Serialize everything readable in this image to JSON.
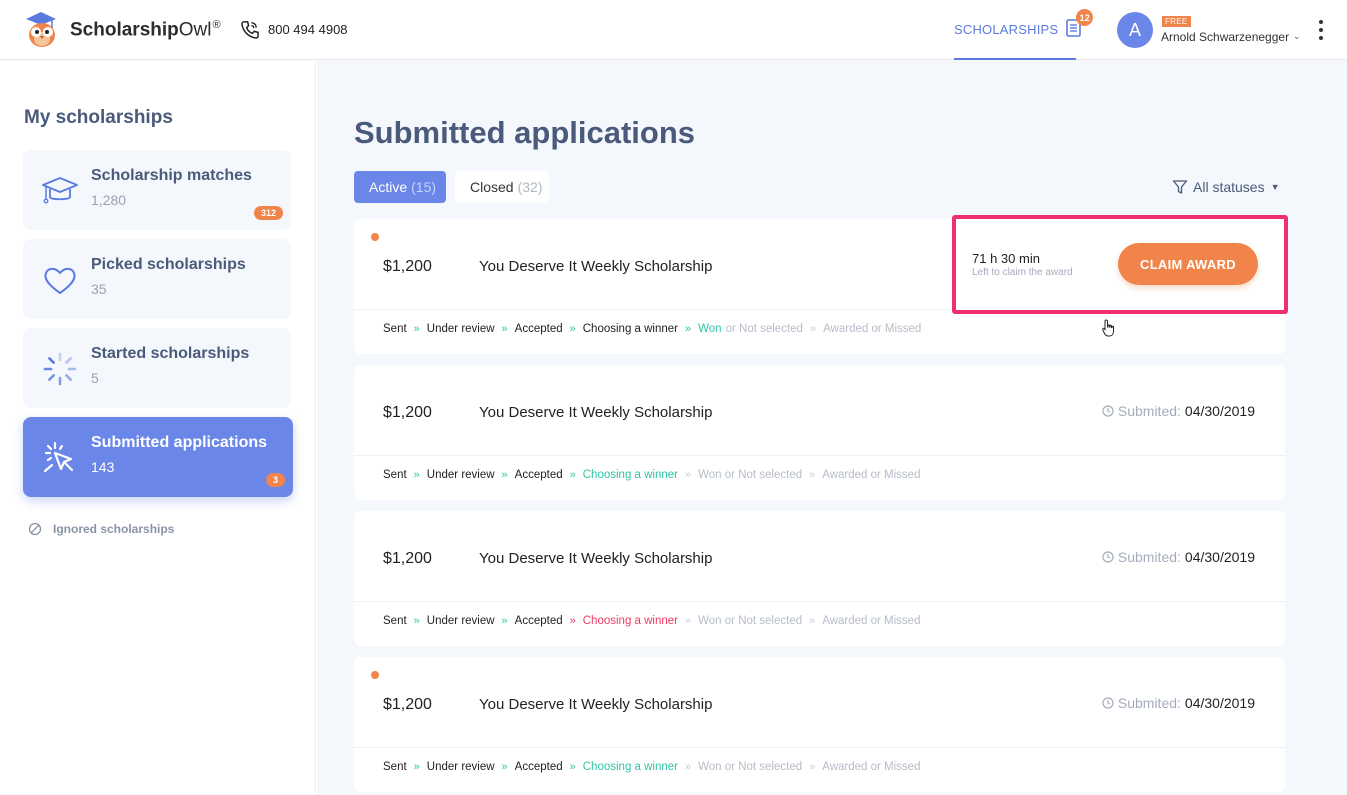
{
  "header": {
    "logo_main": "Scholarship",
    "logo_owl": "Owl",
    "logo_reg": "®",
    "phone": "800 494 4908",
    "nav_scholarships": "SCHOLARSHIPS",
    "nav_badge": "12",
    "avatar_letter": "A",
    "plan_badge": "FREE",
    "username": "Arnold Schwarzenegger",
    "chevron": "⌄"
  },
  "sidebar": {
    "title": "My scholarships",
    "items": [
      {
        "label": "Scholarship matches",
        "count": "1,280",
        "badge": "312",
        "icon": "graduation-cap-icon"
      },
      {
        "label": "Picked scholarships",
        "count": "35",
        "icon": "heart-icon"
      },
      {
        "label": "Started scholarships",
        "count": "5",
        "icon": "loading-spinner-icon"
      },
      {
        "label": "Submitted applications",
        "count": "143",
        "badge": "3",
        "icon": "cursor-click-icon",
        "active": true
      }
    ],
    "ignored": "Ignored scholarships"
  },
  "main": {
    "title": "Submitted applications",
    "tabs": {
      "active_label": "Active",
      "active_count": "(15)",
      "closed_label": "Closed",
      "closed_count": "(32)"
    },
    "filter": "All statuses",
    "claim": {
      "time": "71 h 30 min",
      "sub": "Left to claim the award",
      "button": "CLAIM AWARD"
    },
    "submitted_label": "Submited:",
    "applications": [
      {
        "amount": "$1,200",
        "name": "You Deserve It Weekly Scholarship",
        "date": "",
        "statuses": {
          "sent": "Sent",
          "review": "Under review",
          "accepted": "Accepted",
          "choosing": "Choosing a winner",
          "won": "Won",
          "or1": "or Not selected",
          "awarded": "Awarded or Missed"
        }
      },
      {
        "amount": "$1,200",
        "name": "You Deserve It Weekly Scholarship",
        "date": "04/30/2019",
        "statuses": {
          "sent": "Sent",
          "review": "Under review",
          "accepted": "Accepted",
          "choosing": "Choosing a winner",
          "won": "Won or Not selected",
          "awarded": "Awarded or Missed"
        }
      },
      {
        "amount": "$1,200",
        "name": "You Deserve It Weekly Scholarship",
        "date": "04/30/2019",
        "statuses": {
          "sent": "Sent",
          "review": "Under review",
          "accepted": "Accepted",
          "choosing": "Choosing a winner",
          "won": "Won or Not selected",
          "awarded": "Awarded or Missed"
        }
      },
      {
        "amount": "$1,200",
        "name": "You Deserve It Weekly Scholarship",
        "date": "04/30/2019",
        "statuses": {
          "sent": "Sent",
          "review": "Under review",
          "accepted": "Accepted",
          "choosing": "Choosing a winner",
          "won": "Won or Not selected",
          "awarded": "Awarded or Missed"
        }
      }
    ]
  },
  "colors": {
    "accent": "#6a86e8",
    "orange": "#f0844a",
    "green": "#2fc4a6",
    "red": "#ef3b5f",
    "highlight": "#ee2f6e"
  }
}
